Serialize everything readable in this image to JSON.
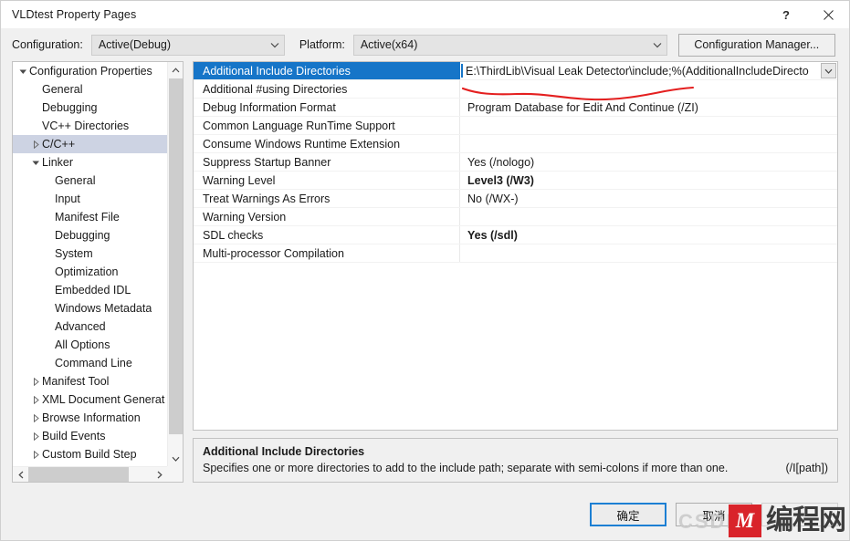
{
  "window": {
    "title": "VLDtest Property Pages",
    "help_icon": "question-mark-icon",
    "close_icon": "close-icon"
  },
  "config_bar": {
    "configuration_label": "Configuration:",
    "configuration_value": "Active(Debug)",
    "platform_label": "Platform:",
    "platform_value": "Active(x64)",
    "configuration_manager_button": "Configuration Manager..."
  },
  "tree": {
    "items": [
      {
        "label": "Configuration Properties",
        "indent": 0,
        "expander": "expanded",
        "selected": false
      },
      {
        "label": "General",
        "indent": 1,
        "expander": "none",
        "selected": false
      },
      {
        "label": "Debugging",
        "indent": 1,
        "expander": "none",
        "selected": false
      },
      {
        "label": "VC++ Directories",
        "indent": 1,
        "expander": "none",
        "selected": false
      },
      {
        "label": "C/C++",
        "indent": 1,
        "expander": "collapsed",
        "selected": true
      },
      {
        "label": "Linker",
        "indent": 1,
        "expander": "expanded",
        "selected": false
      },
      {
        "label": "General",
        "indent": 2,
        "expander": "none",
        "selected": false
      },
      {
        "label": "Input",
        "indent": 2,
        "expander": "none",
        "selected": false
      },
      {
        "label": "Manifest File",
        "indent": 2,
        "expander": "none",
        "selected": false
      },
      {
        "label": "Debugging",
        "indent": 2,
        "expander": "none",
        "selected": false
      },
      {
        "label": "System",
        "indent": 2,
        "expander": "none",
        "selected": false
      },
      {
        "label": "Optimization",
        "indent": 2,
        "expander": "none",
        "selected": false
      },
      {
        "label": "Embedded IDL",
        "indent": 2,
        "expander": "none",
        "selected": false
      },
      {
        "label": "Windows Metadata",
        "indent": 2,
        "expander": "none",
        "selected": false
      },
      {
        "label": "Advanced",
        "indent": 2,
        "expander": "none",
        "selected": false
      },
      {
        "label": "All Options",
        "indent": 2,
        "expander": "none",
        "selected": false
      },
      {
        "label": "Command Line",
        "indent": 2,
        "expander": "none",
        "selected": false
      },
      {
        "label": "Manifest Tool",
        "indent": 1,
        "expander": "collapsed",
        "selected": false
      },
      {
        "label": "XML Document Generator",
        "indent": 1,
        "expander": "collapsed",
        "selected": false
      },
      {
        "label": "Browse Information",
        "indent": 1,
        "expander": "collapsed",
        "selected": false
      },
      {
        "label": "Build Events",
        "indent": 1,
        "expander": "collapsed",
        "selected": false
      },
      {
        "label": "Custom Build Step",
        "indent": 1,
        "expander": "collapsed",
        "selected": false
      }
    ],
    "scroll_up_icon": "chevron-up-icon",
    "scroll_down_icon": "chevron-down-icon",
    "scroll_left_icon": "chevron-left-icon",
    "scroll_right_icon": "chevron-right-icon"
  },
  "grid": {
    "rows": [
      {
        "name": "Additional Include Directories",
        "value": "E:\\ThirdLib\\Visual Leak Detector\\include;%(AdditionalIncludeDirecto",
        "bold": false,
        "selected": true,
        "editing": true
      },
      {
        "name": "Additional #using Directories",
        "value": "",
        "bold": false,
        "selected": false,
        "editing": false
      },
      {
        "name": "Debug Information Format",
        "value": "Program Database for Edit And Continue (/ZI)",
        "bold": false,
        "selected": false,
        "editing": false
      },
      {
        "name": "Common Language RunTime Support",
        "value": "",
        "bold": false,
        "selected": false,
        "editing": false
      },
      {
        "name": "Consume Windows Runtime Extension",
        "value": "",
        "bold": false,
        "selected": false,
        "editing": false
      },
      {
        "name": "Suppress Startup Banner",
        "value": "Yes (/nologo)",
        "bold": false,
        "selected": false,
        "editing": false
      },
      {
        "name": "Warning Level",
        "value": "Level3 (/W3)",
        "bold": true,
        "selected": false,
        "editing": false
      },
      {
        "name": "Treat Warnings As Errors",
        "value": "No (/WX-)",
        "bold": false,
        "selected": false,
        "editing": false
      },
      {
        "name": "Warning Version",
        "value": "",
        "bold": false,
        "selected": false,
        "editing": false
      },
      {
        "name": "SDL checks",
        "value": "Yes (/sdl)",
        "bold": true,
        "selected": false,
        "editing": false
      },
      {
        "name": "Multi-processor Compilation",
        "value": "",
        "bold": false,
        "selected": false,
        "editing": false
      }
    ],
    "value_dropdown_icon": "chevron-down-icon"
  },
  "description": {
    "title": "Additional Include Directories",
    "text": "Specifies one or more directories to add to the include path; separate with semi-colons if more than one.",
    "switch": "(/I[path])"
  },
  "footer": {
    "ok_button": "确定",
    "cancel_button": "取消",
    "apply_button": ""
  },
  "annotations": {
    "red_underline_color": "#e41f1f"
  },
  "watermark": {
    "csdn_text": "CSDN",
    "logo_mark": "M",
    "logo_text": "编程网"
  }
}
